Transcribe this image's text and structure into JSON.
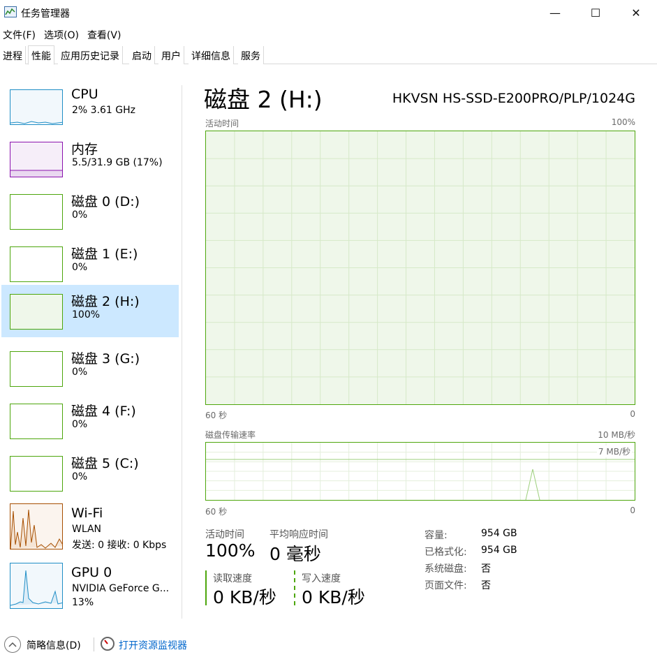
{
  "window": {
    "title": "任务管理器",
    "min_glyph": "—",
    "max_glyph": "☐",
    "close_glyph": "✕"
  },
  "menu": [
    "文件(F)",
    "选项(O)",
    "查看(V)"
  ],
  "tabs": [
    "进程",
    "性能",
    "应用历史记录",
    "启动",
    "用户",
    "详细信息",
    "服务"
  ],
  "active_tab": "性能",
  "sidebar": {
    "items": [
      {
        "title": "CPU",
        "sub": "2% 3.61 GHz",
        "sub2": "",
        "color": "#1f8ec6",
        "fill": "#f2f8fc"
      },
      {
        "title": "内存",
        "sub": "5.5/31.9 GB (17%)",
        "sub2": "",
        "color": "#8b12ae",
        "fill": "#f6eef9"
      },
      {
        "title": "磁盘 0 (D:)",
        "sub": "0%",
        "sub2": "",
        "color": "#4da60c",
        "fill": "#ffffff"
      },
      {
        "title": "磁盘 1 (E:)",
        "sub": "0%",
        "sub2": "",
        "color": "#4da60c",
        "fill": "#ffffff"
      },
      {
        "title": "磁盘 2 (H:)",
        "sub": "100%",
        "sub2": "",
        "color": "#4da60c",
        "fill": "#eff7ea"
      },
      {
        "title": "磁盘 3 (G:)",
        "sub": "0%",
        "sub2": "",
        "color": "#4da60c",
        "fill": "#ffffff"
      },
      {
        "title": "磁盘 4 (F:)",
        "sub": "0%",
        "sub2": "",
        "color": "#4da60c",
        "fill": "#ffffff"
      },
      {
        "title": "磁盘 5 (C:)",
        "sub": "0%",
        "sub2": "",
        "color": "#4da60c",
        "fill": "#ffffff"
      },
      {
        "title": "Wi-Fi",
        "sub": "WLAN",
        "sub2": "发送: 0 接收: 0 Kbps",
        "color": "#a74f01",
        "fill": "#fbf4ee"
      },
      {
        "title": "GPU 0",
        "sub": "NVIDIA GeForce G...",
        "sub2": "13%",
        "color": "#1f8ec6",
        "fill": "#f2f8fc"
      }
    ],
    "selected_index": 4
  },
  "main": {
    "title": "磁盘 2 (H:)",
    "model": "HKVSN HS-SSD-E200PRO/PLP/1024G",
    "graph1": {
      "label": "活动时间",
      "max": "100%",
      "left": "60 秒",
      "right": "0"
    },
    "graph2": {
      "label": "磁盘传输速率",
      "max": "10 MB/秒",
      "inner": "7 MB/秒",
      "left": "60 秒",
      "right": "0"
    },
    "stats": {
      "active_label": "活动时间",
      "active_value": "100%",
      "resp_label": "平均响应时间",
      "resp_value": "0 毫秒",
      "read_label": "读取速度",
      "read_value": "0 KB/秒",
      "write_label": "写入速度",
      "write_value": "0 KB/秒"
    },
    "props": [
      {
        "key": "容量:",
        "value": "954 GB"
      },
      {
        "key": "已格式化:",
        "value": "954 GB"
      },
      {
        "key": "系统磁盘:",
        "value": "否"
      },
      {
        "key": "页面文件:",
        "value": "否"
      }
    ]
  },
  "bottom": {
    "brief": "简略信息(D)",
    "monitor": "打开资源监视器"
  },
  "colors": {
    "disk_green": "#4da60c",
    "selected_bg": "#cce8ff",
    "link": "#0066cc"
  }
}
